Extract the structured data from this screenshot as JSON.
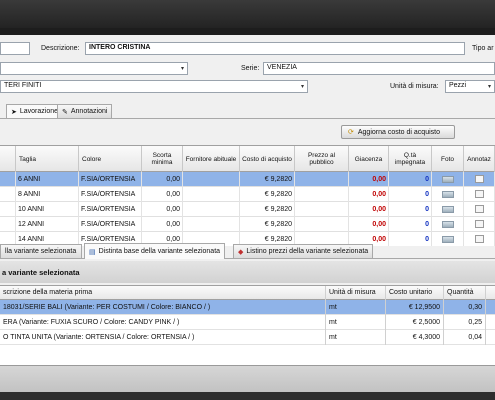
{
  "form": {
    "descrizione_label": "Descrizione:",
    "descrizione_value": "INTERO CRISTINA",
    "tipo_label": "Tipo ar",
    "serie_label": "Serie:",
    "serie_value": "VENEZIA",
    "categoria_value": "TERI FINITI",
    "unita_label": "Unità di misura:",
    "unita_value": "Pezzi"
  },
  "tabs_top": [
    {
      "label": "Lavorazione"
    },
    {
      "label": "Annotazioni"
    }
  ],
  "toolbar": {
    "aggiorna_label": "Aggiorna costo di acquisto"
  },
  "grid": {
    "headers": [
      "Taglia",
      "Colore",
      "Scorta minima",
      "Fornitore abituale",
      "Costo di acquisto",
      "Prezzo al pubblico",
      "Giacenza",
      "Q.tà impegnata",
      "Foto",
      "Annotaz"
    ],
    "rows": [
      {
        "taglia": "6 ANNI",
        "colore": "F.SIA/ORTENSIA",
        "scorta": "0,00",
        "costo": "€ 9,2820",
        "giacenza": "0,00",
        "impegnata": "0"
      },
      {
        "taglia": "8 ANNI",
        "colore": "F.SIA/ORTENSIA",
        "scorta": "0,00",
        "costo": "€ 9,2820",
        "giacenza": "0,00",
        "impegnata": "0"
      },
      {
        "taglia": "10 ANNI",
        "colore": "F.SIA/ORTENSIA",
        "scorta": "0,00",
        "costo": "€ 9,2820",
        "giacenza": "0,00",
        "impegnata": "0"
      },
      {
        "taglia": "12 ANNI",
        "colore": "F.SIA/ORTENSIA",
        "scorta": "0,00",
        "costo": "€ 9,2820",
        "giacenza": "0,00",
        "impegnata": "0"
      },
      {
        "taglia": "14 ANNI",
        "colore": "F.SIA/ORTENSIA",
        "scorta": "0,00",
        "costo": "€ 9,2820",
        "giacenza": "0,00",
        "impegnata": "0"
      }
    ]
  },
  "tabs_bottom": [
    {
      "label": "lla variante selezionata"
    },
    {
      "label": "Distinta base della variante selezionata"
    },
    {
      "label": "Listino prezzi della variante selezionata"
    }
  ],
  "lower": {
    "section_title": "a variante selezionata",
    "headers": [
      "scrizione della materia prima",
      "Unità di misura",
      "Costo unitario",
      "Quantità"
    ],
    "rows": [
      {
        "desc": "18031/SERIE BALI (Variante: PER COSTUMI / Colore: BIANCO / )",
        "um": "mt",
        "costo": "€ 12,9500",
        "qta": "0,30"
      },
      {
        "desc": "ERA  (Variante: FUXIA SCURO / Colore: CANDY PINK / )",
        "um": "mt",
        "costo": "€ 2,5000",
        "qta": "0,25"
      },
      {
        "desc": "O TINTA UNITA  (Variante: ORTENSIA / Colore: ORTENSIA / )",
        "um": "mt",
        "costo": "€ 4,3000",
        "qta": "0,04"
      }
    ]
  },
  "colors": {
    "selection": "#8fb3e8",
    "negative": "#c00000",
    "impegnata": "#1030c0"
  }
}
